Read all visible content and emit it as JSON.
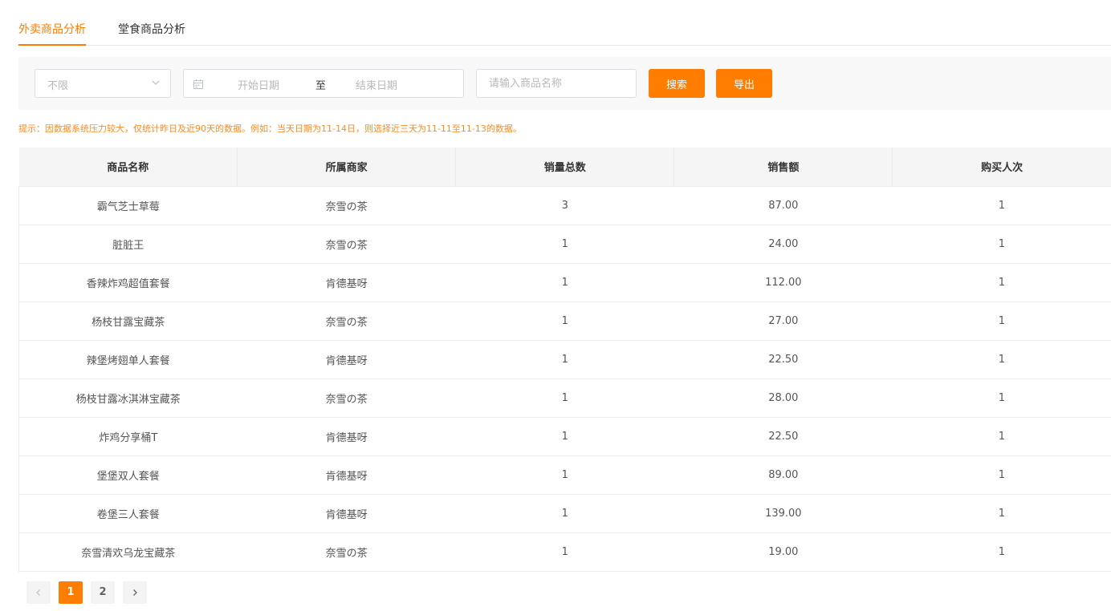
{
  "tabs": [
    {
      "label": "外卖商品分析",
      "active": true
    },
    {
      "label": "堂食商品分析",
      "active": false
    }
  ],
  "filters": {
    "select_value": "不限",
    "start_placeholder": "开始日期",
    "separator": "至",
    "end_placeholder": "结束日期",
    "search_placeholder": "请输入商品名称",
    "search_label": "搜索",
    "export_label": "导出"
  },
  "tip": "提示：因数据系统压力较大，仅统计昨日及近90天的数据。例如：当天日期为11-14日，则选择近三天为11-11至11-13的数据。",
  "table": {
    "headers": [
      "商品名称",
      "所属商家",
      "销量总数",
      "销售额",
      "购买人次"
    ],
    "rows": [
      [
        "霸气芝士草莓",
        "奈雪の茶",
        "3",
        "87.00",
        "1"
      ],
      [
        "脏脏王",
        "奈雪の茶",
        "1",
        "24.00",
        "1"
      ],
      [
        "香辣炸鸡超值套餐",
        "肯德基呀",
        "1",
        "112.00",
        "1"
      ],
      [
        "杨枝甘露宝藏茶",
        "奈雪の茶",
        "1",
        "27.00",
        "1"
      ],
      [
        "辣堡烤翅单人套餐",
        "肯德基呀",
        "1",
        "22.50",
        "1"
      ],
      [
        "杨枝甘露冰淇淋宝藏茶",
        "奈雪の茶",
        "1",
        "28.00",
        "1"
      ],
      [
        "炸鸡分享桶T",
        "肯德基呀",
        "1",
        "22.50",
        "1"
      ],
      [
        "堡堡双人套餐",
        "肯德基呀",
        "1",
        "89.00",
        "1"
      ],
      [
        "卷堡三人套餐",
        "肯德基呀",
        "1",
        "139.00",
        "1"
      ],
      [
        "奈雪清欢乌龙宝藏茶",
        "奈雪の茶",
        "1",
        "19.00",
        "1"
      ]
    ]
  },
  "pagination": {
    "pages": [
      "1",
      "2"
    ],
    "current": "1"
  },
  "colors": {
    "accent": "#ff7d00",
    "tip": "#ff8a1f"
  }
}
